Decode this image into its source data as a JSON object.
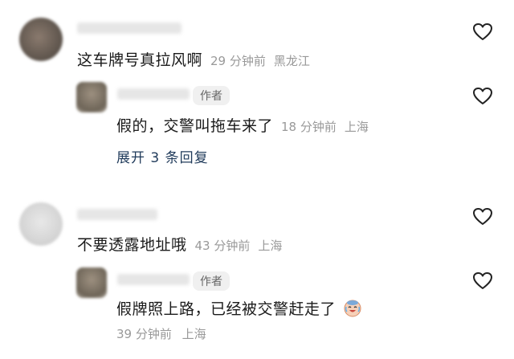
{
  "comments": [
    {
      "text": "这车牌号真拉风啊",
      "time": "29 分钟前",
      "location": "黑龙江",
      "icon": "heart-icon"
    },
    {
      "badge": "作者",
      "text": "假的，交警叫拖车来了",
      "time": "18 分钟前",
      "location": "上海",
      "icon": "heart-icon"
    },
    {
      "expand_label": "展开 3 条回复"
    },
    {
      "text": "不要透露地址哦",
      "time": "43 分钟前",
      "location": "上海",
      "icon": "heart-icon"
    },
    {
      "badge": "作者",
      "text": "假牌照上路，已经被交警赶走了",
      "emoji": "crying-laughing-emoji",
      "time": "39 分钟前",
      "location": "上海",
      "icon": "heart-icon"
    }
  ],
  "colors": {
    "meta_gray": "#999999",
    "expand_link": "#1f3a5a",
    "badge_bg": "#f0f0f0",
    "separator": "#eeeeee"
  }
}
